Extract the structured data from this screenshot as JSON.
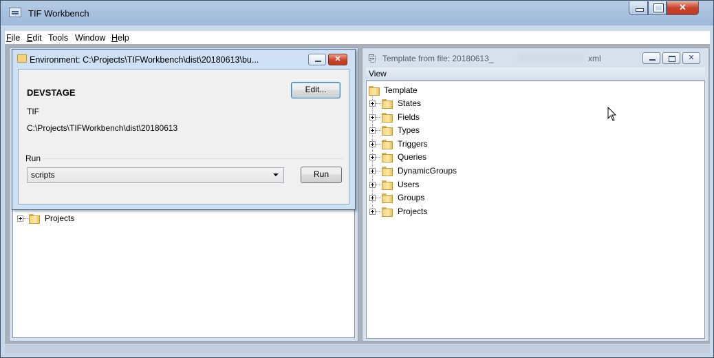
{
  "app": {
    "title": "TIF Workbench"
  },
  "menu": [
    {
      "label": "File",
      "u": "F",
      "rest": "ile"
    },
    {
      "label": "Edit",
      "u": "E",
      "rest": "dit"
    },
    {
      "label": "Tools",
      "u": "",
      "rest": "Tools"
    },
    {
      "label": "Window",
      "u": "",
      "rest": "Window"
    },
    {
      "label": "Help",
      "u": "H",
      "rest": "elp"
    }
  ],
  "environment": {
    "title": "Environment: C:\\Projects\\TIFWorkbench\\dist\\20180613\\bu...",
    "name": "DEVSTAGE",
    "type": "TIF",
    "path": "C:\\Projects\\TIFWorkbench\\dist\\20180613",
    "edit_label": "Edit...",
    "run_group_label": "Run",
    "run_selected": "scripts",
    "run_button": "Run"
  },
  "left_tree": {
    "items": [
      "Projects"
    ]
  },
  "template_window": {
    "title_prefix": "Template from file: 20180613_",
    "title_suffix": "xml",
    "view_menu": "View",
    "root": "Template",
    "items": [
      "States",
      "Fields",
      "Types",
      "Triggers",
      "Queries",
      "DynamicGroups",
      "Users",
      "Groups",
      "Projects"
    ]
  },
  "colors": {
    "accent": "#1e5799",
    "close_red": "#c8442c",
    "folder": "#f3d27a"
  },
  "icons": {
    "close": "close-icon",
    "minimize": "minimize-icon",
    "maximize": "maximize-icon",
    "folder": "folder-icon",
    "expand": "plus-expander-icon"
  }
}
